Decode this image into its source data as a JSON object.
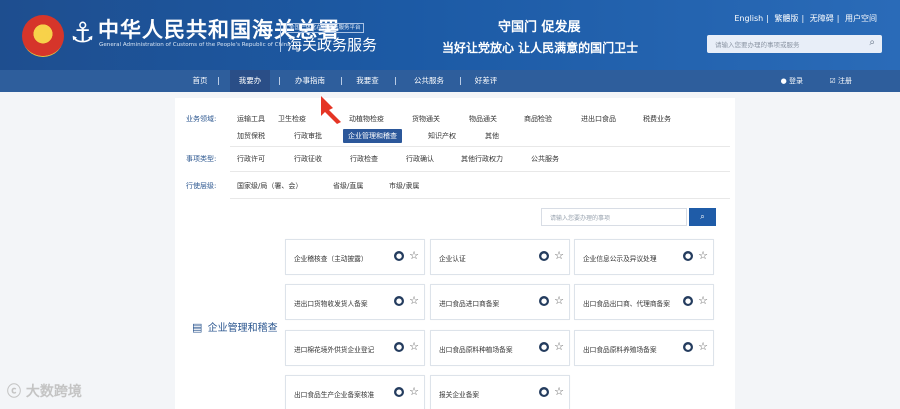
{
  "header": {
    "brand_title": "中华人民共和国海关总署",
    "brand_en": "General Administration of Customs of the People's Republic of China",
    "portal_small": "全国一体化在线政务服务平台",
    "portal_big": "海关政务服务",
    "slogan1": "守国门   促发展",
    "slogan2": "当好让党放心   让人民满意的国门卫士",
    "top_links": [
      "English",
      "繁體版",
      "无障碍",
      "用户空间"
    ],
    "search_placeholder": "请输入您要办理的事项或服务"
  },
  "nav": {
    "items": [
      "首页",
      "我要办",
      "办事指南",
      "我要查",
      "公共服务",
      "好差评"
    ],
    "login": "登录",
    "register": "注册"
  },
  "filters": {
    "business_label": "业务领域:",
    "business_items_row1": [
      "运输工具",
      "卫生检疫",
      "动植物检疫",
      "货物通关",
      "物品通关",
      "商品检验",
      "进出口食品",
      "税费业务"
    ],
    "business_items_row2": [
      "加贸保税",
      "行政审批",
      "企业管理和稽查",
      "知识产权",
      "其他"
    ],
    "type_label": "事项类型:",
    "type_items": [
      "行政许可",
      "行政征收",
      "行政检查",
      "行政确认",
      "其他行政权力",
      "公共服务"
    ],
    "level_label": "行使层级:",
    "level_items": [
      "国家级/局（署、会）",
      "省级/直属",
      "市级/隶属"
    ]
  },
  "search": {
    "placeholder": "请输入您要办理的事项"
  },
  "category": {
    "label": "企业管理和稽查"
  },
  "cards": [
    "企业稽核查（主动披露）",
    "企业认证",
    "企业信息公示及异议处理",
    "进出口货物收发货人备案",
    "进口食品进口商备案",
    "出口食品出口商、代理商备案",
    "进口棉花境外供货企业登记",
    "出口食品原料种植场备案",
    "出口食品原料养殖场备案",
    "出口食品生产企业备案核准",
    "报关企业备案"
  ],
  "watermark": "大数跨境"
}
